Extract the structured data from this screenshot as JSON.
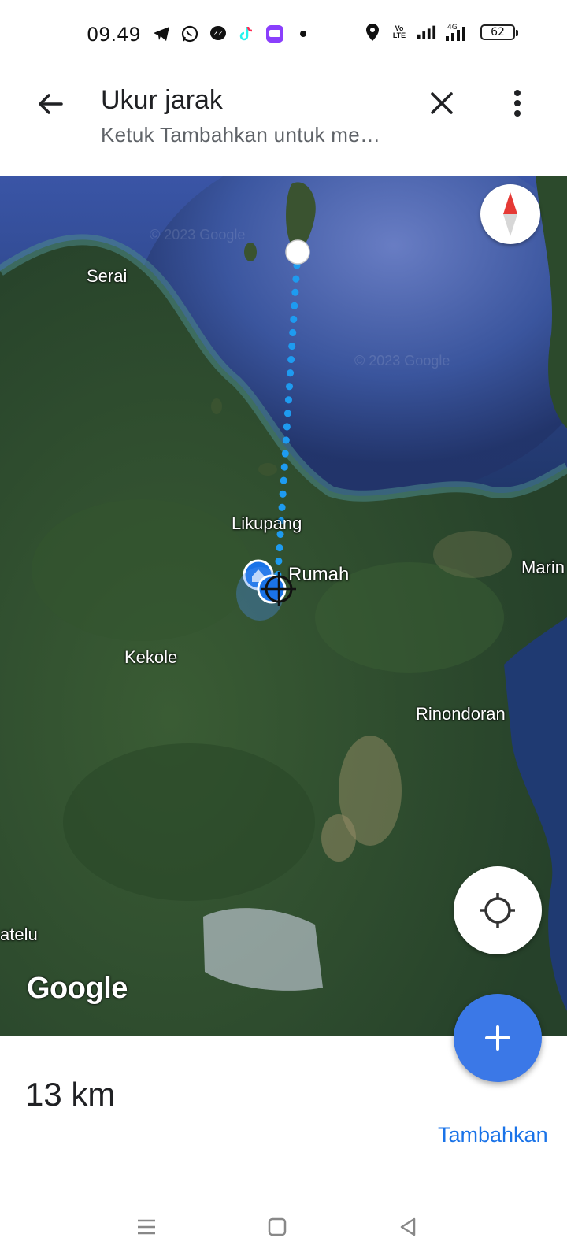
{
  "status_bar": {
    "time": "09.49",
    "battery": "62",
    "network": "4G",
    "volte": "Vo LTE"
  },
  "app_bar": {
    "title": "Ukur jarak",
    "subtitle": "Ketuk Tambahkan untuk me…"
  },
  "map": {
    "labels": {
      "serai": "Serai",
      "likupang": "Likupang",
      "rumah": "Rumah",
      "marin": "Marin",
      "kekole": "Kekole",
      "rinondoran": "Rinondoran",
      "atelu": "atelu"
    },
    "watermark": "© 2023 Google",
    "logo": "Google"
  },
  "measurement": {
    "distance": "13 km",
    "add_label": "Tambahkan"
  },
  "colors": {
    "accent": "#1a73e8",
    "fab": "#3b78e7",
    "route": "#1e9bf0",
    "water": "#2a3f78",
    "land": "#2f5030"
  },
  "icons": {
    "back": "arrow-left-icon",
    "close": "close-icon",
    "more": "more-vert-icon",
    "compass": "compass-icon",
    "locate": "my-location-icon",
    "add": "plus-icon"
  }
}
